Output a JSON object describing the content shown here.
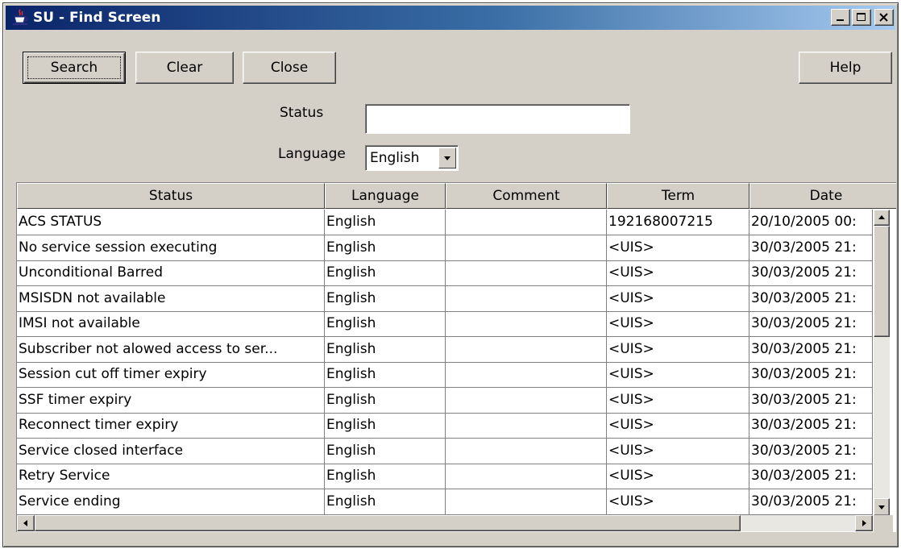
{
  "window": {
    "title": "SU - Find Screen"
  },
  "toolbar": {
    "search_label": "Search",
    "clear_label": "Clear",
    "close_label": "Close",
    "help_label": "Help"
  },
  "form": {
    "status_label": "Status",
    "status_value": "",
    "language_label": "Language",
    "language_value": "English"
  },
  "table": {
    "columns": [
      "Status",
      "Language",
      "Comment",
      "Term",
      "Date"
    ],
    "rows": [
      [
        "ACS STATUS",
        "English",
        "",
        "192168007215",
        "20/10/2005 00:"
      ],
      [
        "No service session executing",
        "English",
        "",
        "<UIS>",
        "30/03/2005 21:"
      ],
      [
        "Unconditional Barred",
        "English",
        "",
        "<UIS>",
        "30/03/2005 21:"
      ],
      [
        "MSISDN not available",
        "English",
        "",
        "<UIS>",
        "30/03/2005 21:"
      ],
      [
        "IMSI not available",
        "English",
        "",
        "<UIS>",
        "30/03/2005 21:"
      ],
      [
        "Subscriber not alowed access to ser...",
        "English",
        "",
        "<UIS>",
        "30/03/2005 21:"
      ],
      [
        "Session cut off timer expiry",
        "English",
        "",
        "<UIS>",
        "30/03/2005 21:"
      ],
      [
        "SSF timer expiry",
        "English",
        "",
        "<UIS>",
        "30/03/2005 21:"
      ],
      [
        "Reconnect timer expiry",
        "English",
        "",
        "<UIS>",
        "30/03/2005 21:"
      ],
      [
        "Service closed interface",
        "English",
        "",
        "<UIS>",
        "30/03/2005 21:"
      ],
      [
        "Retry Service",
        "English",
        "",
        "<UIS>",
        "30/03/2005 21:"
      ],
      [
        "Service ending",
        "English",
        "",
        "<UIS>",
        "30/03/2005 21:"
      ]
    ]
  },
  "icons": {
    "app": "java-coffee-cup-icon",
    "minimize": "minimize-icon",
    "maximize": "maximize-icon",
    "close": "close-icon",
    "combo_arrow": "chevron-down-icon"
  },
  "colors": {
    "titlebar_start": "#0a246a",
    "titlebar_end": "#a6caf0",
    "face": "#d4d0c8"
  }
}
